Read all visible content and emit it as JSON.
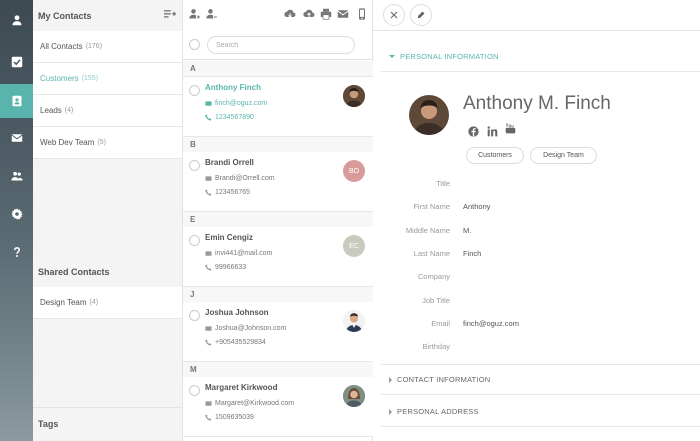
{
  "rail": {
    "items": [
      {
        "icon": "user-icon"
      },
      {
        "icon": "check-icon"
      },
      {
        "icon": "contacts-icon",
        "active": true
      },
      {
        "icon": "mail-icon"
      },
      {
        "icon": "users-icon"
      },
      {
        "icon": "gear-icon"
      },
      {
        "icon": "help-icon"
      }
    ]
  },
  "groups": {
    "my_contacts_header": "My Contacts",
    "items": [
      {
        "label": "All Contacts",
        "count": "(176)"
      },
      {
        "label": "Customers",
        "count": "(155)",
        "selected": true
      },
      {
        "label": "Leads",
        "count": "(4)"
      },
      {
        "label": "Web Dev Team",
        "count": "(5)"
      }
    ],
    "shared_header": "Shared Contacts",
    "shared_items": [
      {
        "label": "Design Team",
        "count": "(4)"
      }
    ],
    "tags_header": "Tags"
  },
  "list": {
    "search_placeholder": "Search",
    "sections": [
      {
        "letter": "A",
        "contacts": [
          {
            "name": "Anthony Finch",
            "email": "finch@oguz.com",
            "phone": "1234567890",
            "selected": true,
            "avatar": "photo"
          }
        ]
      },
      {
        "letter": "B",
        "contacts": [
          {
            "name": "Brandi Orrell",
            "email": "Brandi@Orrell.com",
            "phone": "123456765",
            "initials": "BO",
            "avatar_color": "#d99a9a"
          }
        ]
      },
      {
        "letter": "E",
        "contacts": [
          {
            "name": "Emin Cengiz",
            "email": "invi441@mail.com",
            "phone": "99966633",
            "initials": "EC",
            "avatar_color": "#c9c9bd"
          }
        ]
      },
      {
        "letter": "J",
        "contacts": [
          {
            "name": "Joshua Johnson",
            "email": "Joshua@Johnson.com",
            "phone": "+905435529834",
            "avatar": "photo"
          }
        ]
      },
      {
        "letter": "M",
        "contacts": [
          {
            "name": "Margaret Kirkwood",
            "email": "Margaret@Kirkwood.com",
            "phone": "1509635039",
            "avatar": "photo"
          }
        ]
      }
    ]
  },
  "detail": {
    "sections": {
      "personal_info": "PERSONAL INFORMATION",
      "contact_info": "CONTACT INFORMATION",
      "personal_address": "PERSONAL ADDRESS"
    },
    "full_name": "Anthony M. Finch",
    "tags": [
      "Customers",
      "Design Team"
    ],
    "fields": [
      {
        "label": "Title",
        "value": ""
      },
      {
        "label": "First Name",
        "value": "Anthony"
      },
      {
        "label": "Middle Name",
        "value": "M."
      },
      {
        "label": "Last Name",
        "value": "Finch"
      },
      {
        "label": "Company",
        "value": ""
      },
      {
        "label": "Job Title",
        "value": ""
      },
      {
        "label": "Email",
        "value": "finch@oguz.com"
      },
      {
        "label": "Birthday",
        "value": ""
      }
    ]
  },
  "colors": {
    "accent": "#5ab4ae"
  }
}
